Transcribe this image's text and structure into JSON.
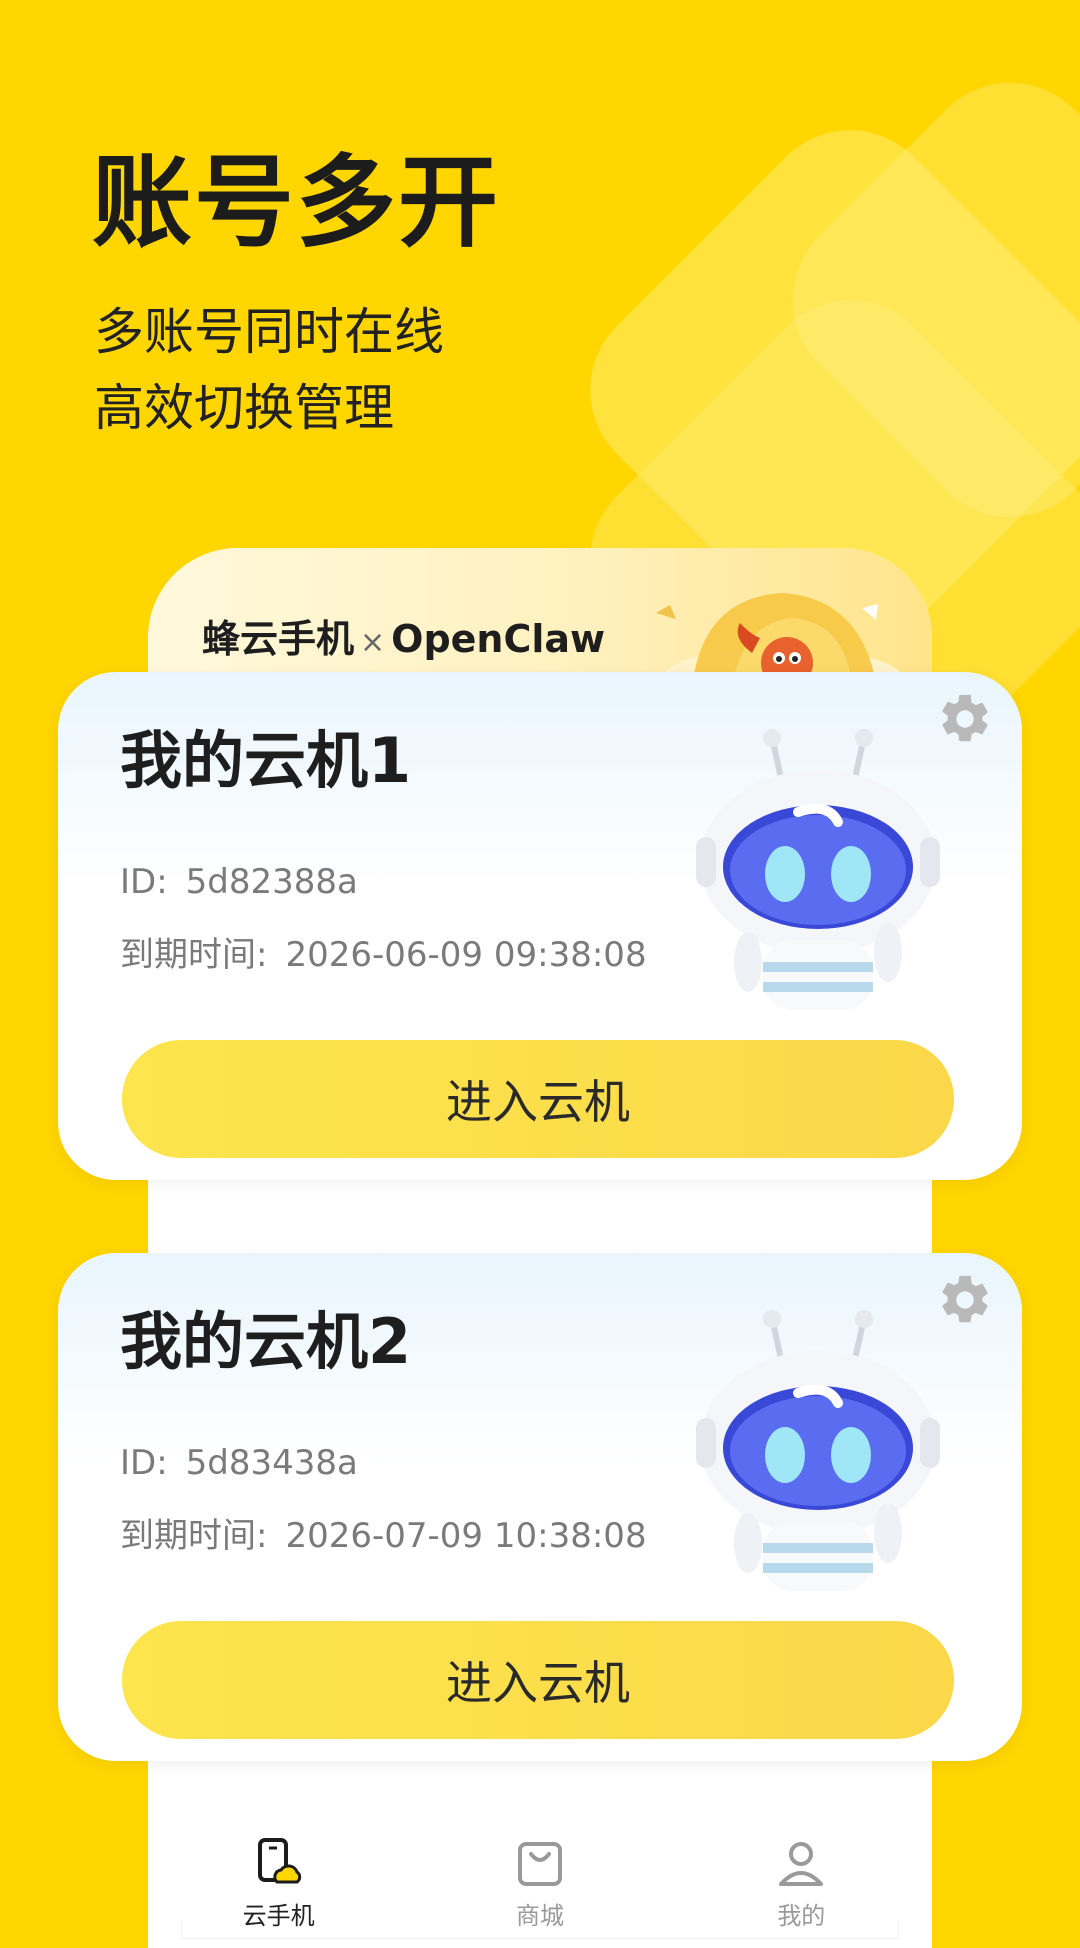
{
  "hero": {
    "title": "账号多开",
    "subtitle_line1": "多账号同时在线",
    "subtitle_line2": "高效切换管理"
  },
  "banner": {
    "brand": "蜂云手机",
    "separator": "×",
    "partner": "OpenClaw"
  },
  "cards": [
    {
      "title": "我的云机1",
      "id_label": "ID:",
      "id_value": "5d82388a",
      "expiry_label": "到期时间:",
      "expiry_value": "2026-06-09 09:38:08",
      "button_label": "进入云机"
    },
    {
      "title": "我的云机2",
      "id_label": "ID:",
      "id_value": "5d83438a",
      "expiry_label": "到期时间:",
      "expiry_value": "2026-07-09 10:38:08",
      "button_label": "进入云机"
    }
  ],
  "nav": {
    "items": [
      {
        "label": "云手机",
        "icon": "cloud-phone-icon",
        "active": true
      },
      {
        "label": "商城",
        "icon": "shopping-bag-icon",
        "active": false
      },
      {
        "label": "我的",
        "icon": "profile-icon",
        "active": false
      }
    ]
  },
  "colors": {
    "background": "#FFD600",
    "button": "#FDE54D",
    "text_primary": "#1E1E1E",
    "text_secondary": "#7A7A7A"
  }
}
